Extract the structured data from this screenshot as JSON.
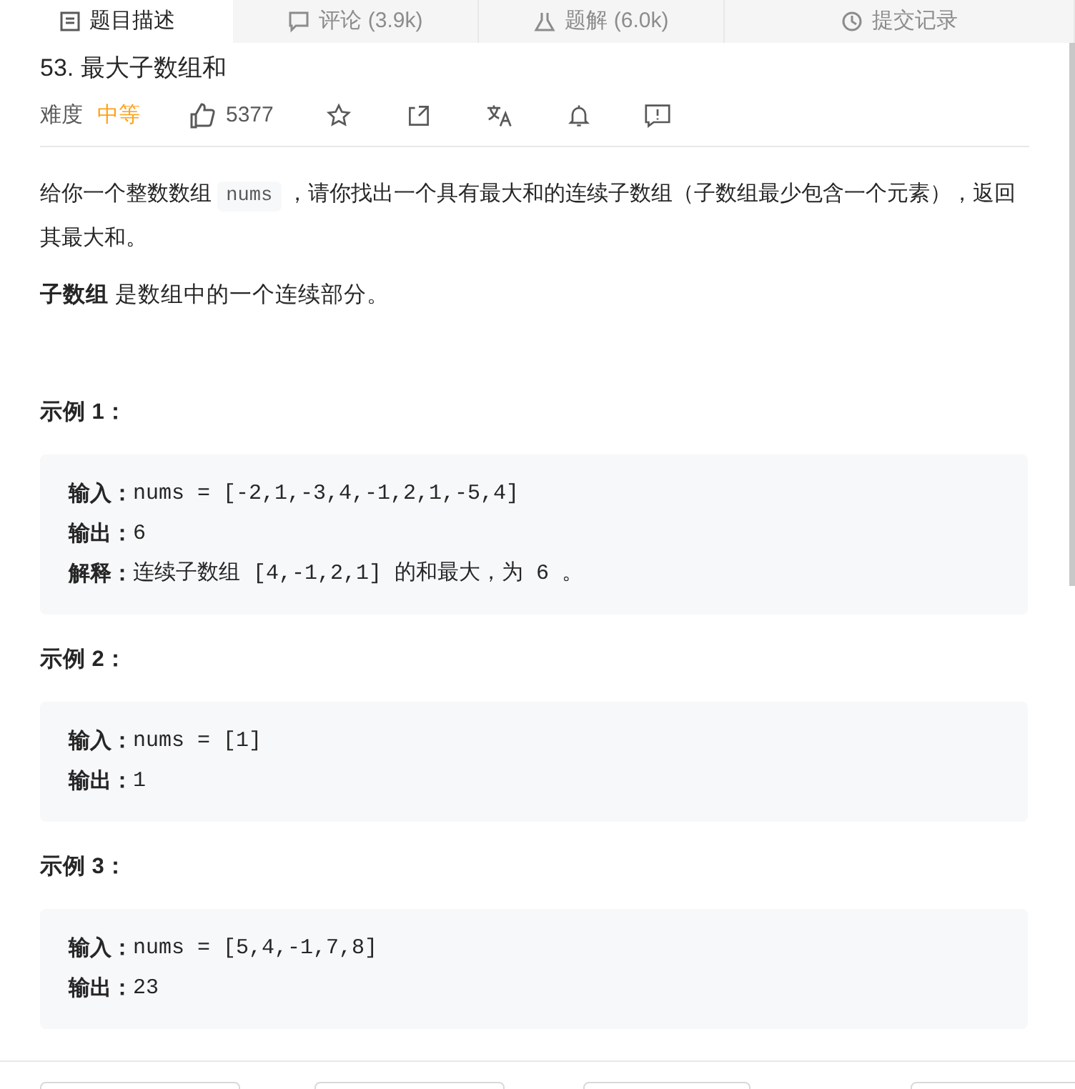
{
  "tabs": [
    {
      "label": "题目描述",
      "selected": true
    },
    {
      "label": "评论 (3.9k)",
      "selected": false
    },
    {
      "label": "题解 (6.0k)",
      "selected": false
    },
    {
      "label": "提交记录",
      "selected": false
    }
  ],
  "problem": {
    "title": "53. 最大子数组和",
    "difficulty_label": "难度",
    "difficulty": "中等",
    "likes": "5377"
  },
  "description": [
    {
      "kind": "text",
      "text": "给你一个整数数组 "
    },
    {
      "kind": "code",
      "text": "nums"
    },
    {
      "kind": "text",
      "text": " ，请你找出一个具有最大和的连续子数组（子数组最少包含一个元素），返回其最大和。"
    }
  ],
  "note": "**子数组** 是数组中的一个连续部分。",
  "examples": [
    {
      "heading": "示例 1：",
      "lines": [
        {
          "label": "输入：",
          "value": "nums = [-2,1,-3,4,-1,2,1,-5,4]"
        },
        {
          "label": "输出：",
          "value": "6"
        },
        {
          "label": "解释：",
          "value": "连续子数组 [4,-1,2,1] 的和最大，为 6 。"
        }
      ]
    },
    {
      "heading": "示例 2：",
      "lines": [
        {
          "label": "输入：",
          "value": "nums = [1]"
        },
        {
          "label": "输出：",
          "value": "1"
        }
      ]
    },
    {
      "heading": "示例 3：",
      "lines": [
        {
          "label": "输入：",
          "value": "nums = [5,4,-1,7,8]"
        },
        {
          "label": "输出：",
          "value": "23"
        }
      ]
    }
  ]
}
